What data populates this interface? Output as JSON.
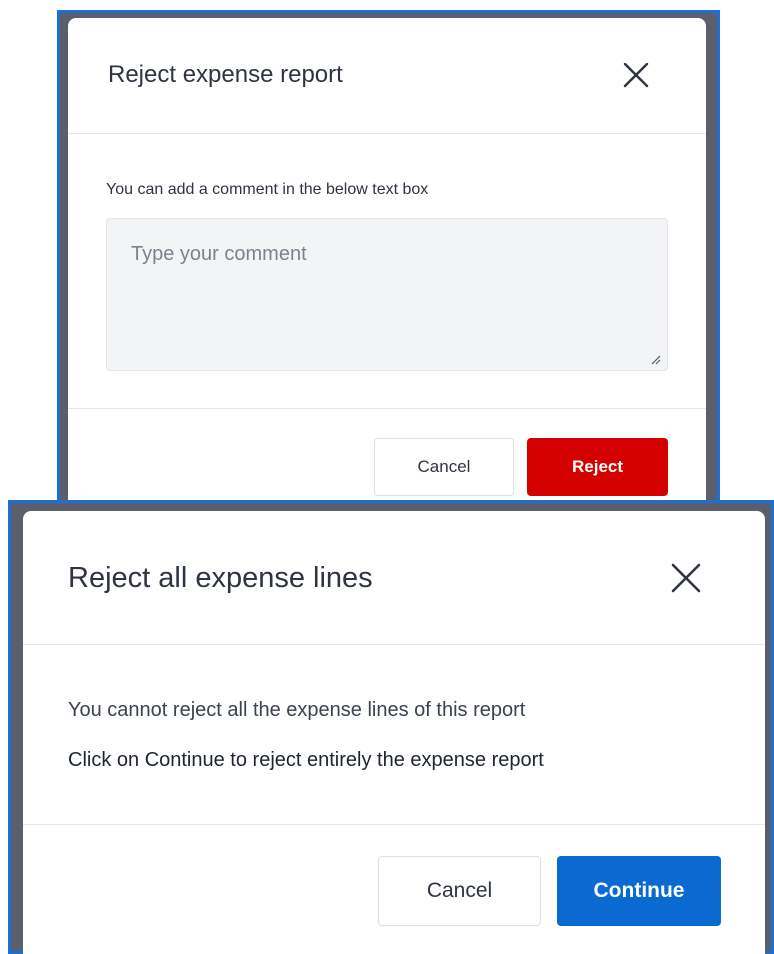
{
  "reject_report_dialog": {
    "title": "Reject expense report",
    "close_icon": "close-icon",
    "hint": "You can add a comment in the below text box",
    "comment": {
      "value": "",
      "placeholder": "Type your comment"
    },
    "cancel_label": "Cancel",
    "reject_label": "Reject"
  },
  "reject_lines_dialog": {
    "title": "Reject all expense lines",
    "close_icon": "close-icon",
    "message_line1": "You cannot reject all the expense lines of this report",
    "message_line2": "Click on Continue to reject entirely the expense report",
    "cancel_label": "Cancel",
    "continue_label": "Continue"
  },
  "colors": {
    "reject": "#d40000",
    "continue": "#0a6ad1",
    "overlay": "#5a5f6b",
    "frame_border": "#1d6fd6"
  }
}
